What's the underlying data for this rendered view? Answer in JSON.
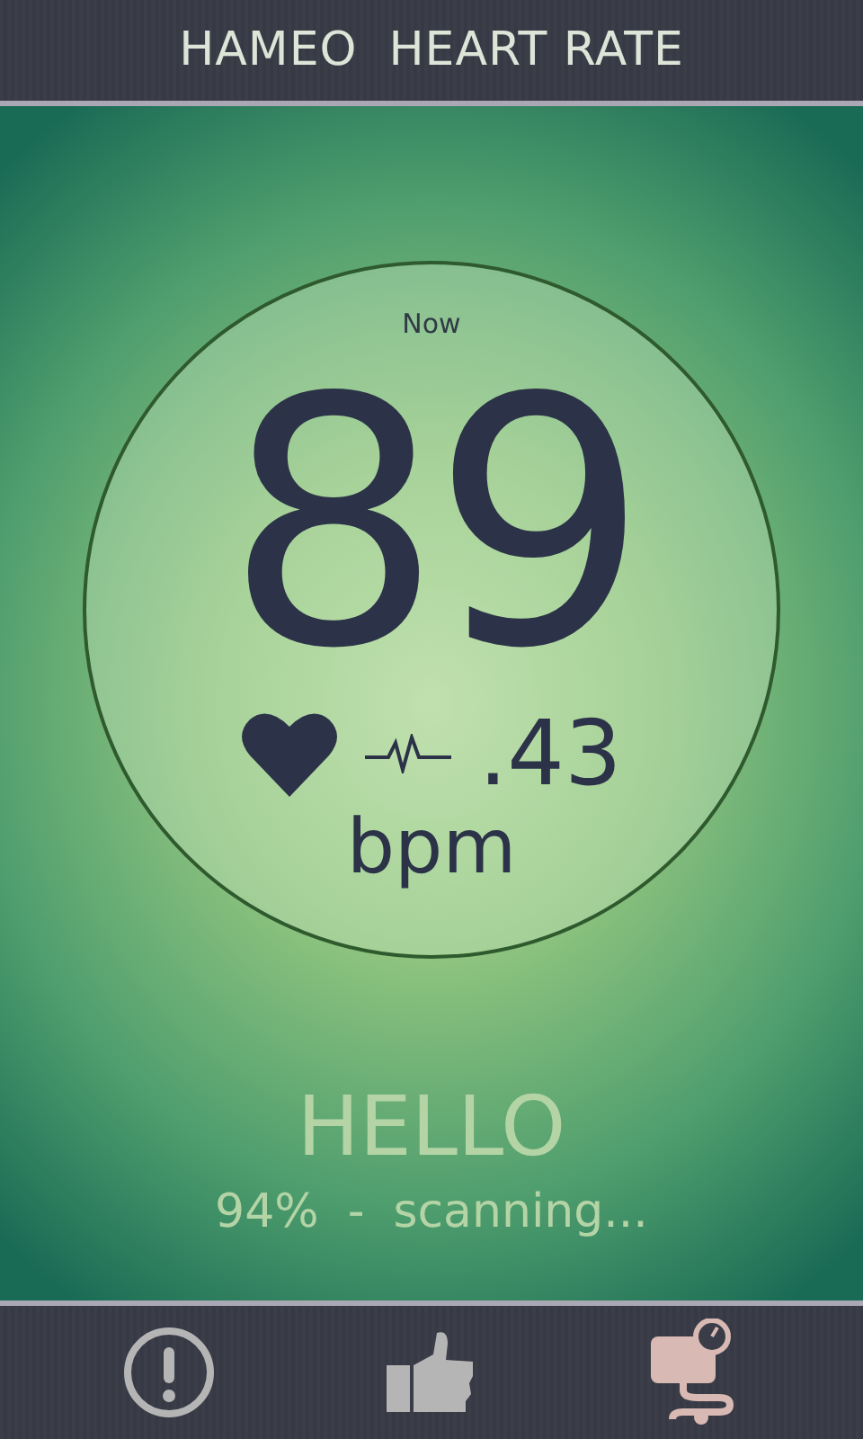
{
  "header": {
    "title": "HAMEO  HEART RATE"
  },
  "reading": {
    "label": "Now",
    "value": "89",
    "decimal": ".43",
    "unit": "bpm"
  },
  "status": {
    "greeting": "HELLO",
    "progress": "94%",
    "separator": "-",
    "state": "scanning..."
  },
  "toolbar": [
    {
      "kind": "alert",
      "selected": false
    },
    {
      "kind": "like",
      "selected": false
    },
    {
      "kind": "device",
      "selected": true
    }
  ]
}
